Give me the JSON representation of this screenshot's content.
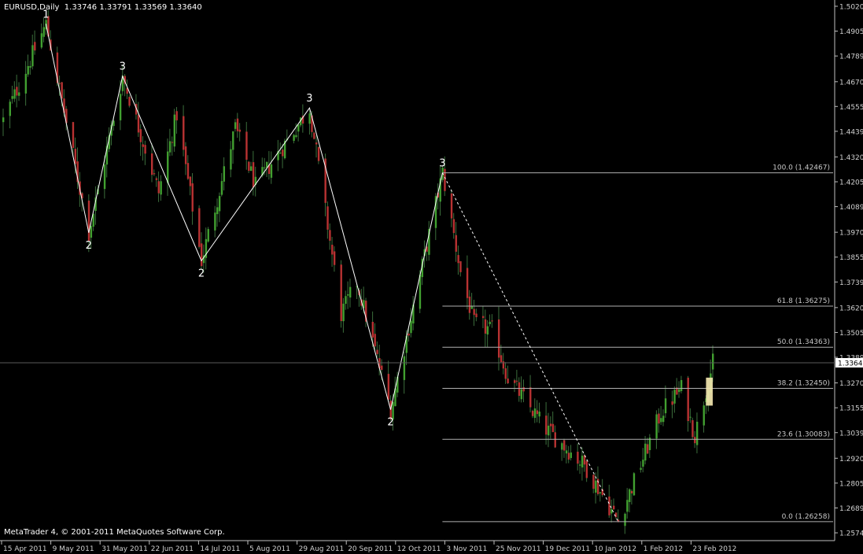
{
  "header": {
    "symbol": "EURUSD,Daily",
    "ohlc": "1.33746 1.33791 1.33569 1.33640"
  },
  "footer": {
    "copyright": "MetaTrader 4, © 2001-2011 MetaQuotes Software Corp."
  },
  "colors": {
    "background": "#000000",
    "axis": "#c0c0c0",
    "bull_fill": "#41a030",
    "bear_fill": "#b83232",
    "wick": "#3c6e3c",
    "price_label_bg": "#ffffff",
    "fib_line": "#b0b0b0",
    "highlight": "#f5e8b0"
  },
  "chart_data": {
    "type": "candlestick",
    "symbol": "EURUSD",
    "timeframe": "Daily",
    "ylim": [
      1.2545,
      1.5035
    ],
    "y_ticks": [
      "1.50205",
      "1.49050",
      "1.47895",
      "1.46700",
      "1.45550",
      "1.44395",
      "1.43205",
      "1.42050",
      "1.40895",
      "1.39705",
      "1.38550",
      "1.37395",
      "1.36205",
      "1.35050",
      "1.33895",
      "1.32705",
      "1.31550",
      "1.30395",
      "1.29205",
      "1.28050",
      "1.26895",
      "1.25740"
    ],
    "current_price": "1.33640",
    "current_price_value": 1.3364,
    "x_ticks": [
      "15 Apr 2011",
      "9 May 2011",
      "31 May 2011",
      "22 Jun 2011",
      "14 Jul 2011",
      "5 Aug 2011",
      "29 Aug 2011",
      "20 Sep 2011",
      "12 Oct 2011",
      "3 Nov 2011",
      "25 Nov 2011",
      "19 Dec 2011",
      "10 Jan 2012",
      "1 Feb 2012",
      "23 Feb 2012"
    ],
    "fibonacci": {
      "levels": [
        {
          "label": "100.0 (1.42467)",
          "price": 1.42467
        },
        {
          "label": "61.8 (1.36275)",
          "price": 1.36275
        },
        {
          "label": "50.0 (1.34363)",
          "price": 1.34363
        },
        {
          "label": "38.2 (1.32450)",
          "price": 1.3245
        },
        {
          "label": "23.6 (1.30083)",
          "price": 1.30083
        },
        {
          "label": "0.0 (1.26258)",
          "price": 1.26258
        }
      ]
    },
    "wave_points": [
      {
        "label": "1",
        "date": "2011-05-04",
        "price": 1.4939
      },
      {
        "label": "2",
        "date": "2011-05-23",
        "price": 1.3968
      },
      {
        "label": "3",
        "date": "2011-06-07",
        "price": 1.4696
      },
      {
        "label": "2",
        "date": "2011-07-12",
        "price": 1.3838
      },
      {
        "label": "3",
        "date": "2011-08-29",
        "price": 1.4548
      },
      {
        "label": "2",
        "date": "2011-10-04",
        "price": 1.3146
      },
      {
        "label": "3",
        "date": "2011-10-27",
        "price": 1.4247
      },
      {
        "label": "",
        "date": "2012-01-13",
        "price": 1.2626
      }
    ],
    "trend_dotted": {
      "from": {
        "date": "2011-10-27",
        "price": 1.4247
      },
      "to": {
        "date": "2012-01-13",
        "price": 1.2626
      }
    },
    "highlight_box": {
      "date_from": "2012-02-21",
      "date_to": "2012-02-24",
      "price_top": 1.3295,
      "price_bottom": 1.3165
    },
    "anchors": [
      {
        "date": "2011-04-15",
        "price": 1.449
      },
      {
        "date": "2011-05-04",
        "price": 1.4939
      },
      {
        "date": "2011-05-23",
        "price": 1.3968
      },
      {
        "date": "2011-06-07",
        "price": 1.4696
      },
      {
        "date": "2011-06-23",
        "price": 1.4155
      },
      {
        "date": "2011-07-01",
        "price": 1.452
      },
      {
        "date": "2011-07-12",
        "price": 1.3838
      },
      {
        "date": "2011-07-27",
        "price": 1.4455
      },
      {
        "date": "2011-08-05",
        "price": 1.4185
      },
      {
        "date": "2011-08-29",
        "price": 1.4548
      },
      {
        "date": "2011-09-12",
        "price": 1.359
      },
      {
        "date": "2011-09-19",
        "price": 1.3738
      },
      {
        "date": "2011-10-04",
        "price": 1.3146
      },
      {
        "date": "2011-10-27",
        "price": 1.4247
      },
      {
        "date": "2011-11-04",
        "price": 1.3785
      },
      {
        "date": "2011-11-10",
        "price": 1.3545
      },
      {
        "date": "2011-11-18",
        "price": 1.3515
      },
      {
        "date": "2011-11-25",
        "price": 1.3295
      },
      {
        "date": "2011-12-12",
        "price": 1.3055
      },
      {
        "date": "2011-12-29",
        "price": 1.2888
      },
      {
        "date": "2012-01-13",
        "price": 1.2626
      },
      {
        "date": "2012-02-01",
        "price": 1.3135
      },
      {
        "date": "2012-02-10",
        "price": 1.3245
      },
      {
        "date": "2012-02-16",
        "price": 1.3025
      },
      {
        "date": "2012-02-24",
        "price": 1.3364
      }
    ]
  }
}
